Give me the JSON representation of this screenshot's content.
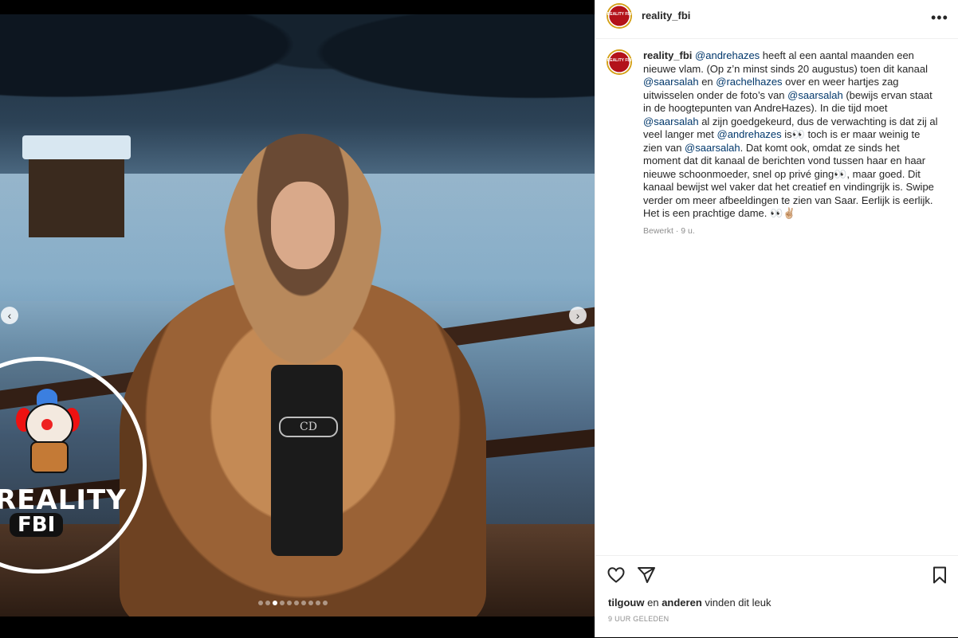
{
  "post": {
    "username": "reality_fbi",
    "avatar_text": "REALITY FBI",
    "more_icon": "more-horizontal-icon",
    "image_alt_logo": {
      "line1": "REALITY",
      "line2": "FBI"
    },
    "belt_text": "CD",
    "carousel": {
      "total": 10,
      "active_index": 2
    }
  },
  "caption": {
    "username": "reality_fbi",
    "segments": [
      {
        "t": "text",
        "v": " "
      },
      {
        "t": "mention",
        "v": "@andrehazes"
      },
      {
        "t": "text",
        "v": " heeft al een aantal maanden een nieuwe vlam. (Op z’n minst sinds 20 augustus) toen dit kanaal "
      },
      {
        "t": "mention",
        "v": "@saarsalah"
      },
      {
        "t": "text",
        "v": " en "
      },
      {
        "t": "mention",
        "v": "@rachelhazes"
      },
      {
        "t": "text",
        "v": " over en weer hartjes zag uitwisselen onder de foto’s van "
      },
      {
        "t": "mention",
        "v": "@saarsalah"
      },
      {
        "t": "text",
        "v": " (bewijs ervan staat in de hoogtepunten van AndreHazes). In die tijd moet "
      },
      {
        "t": "mention",
        "v": "@saarsalah"
      },
      {
        "t": "text",
        "v": " al zijn goedgekeurd, dus de verwachting is dat zij al veel langer met "
      },
      {
        "t": "mention",
        "v": "@andrehazes"
      },
      {
        "t": "text",
        "v": " is👀 toch is er maar weinig te zien van "
      },
      {
        "t": "mention",
        "v": "@saarsalah"
      },
      {
        "t": "text",
        "v": ". Dat komt ook, omdat ze sinds het moment dat dit kanaal de berichten vond tussen haar en haar nieuwe schoonmoeder, snel op privé ging👀, maar goed. Dit kanaal bewijst wel vaker dat het creatief en vindingrijk is. Swipe verder om meer afbeeldingen te zien van Saar. Eerlijk is eerlijk. Het is een prachtige dame. 👀✌🏼"
      }
    ],
    "meta": "Bewerkt · 9 u."
  },
  "actions": {
    "like_icon": "heart-icon",
    "share_icon": "send-icon",
    "save_icon": "bookmark-icon",
    "likes": {
      "user": "tilgouw",
      "connector": " en ",
      "others": "anderen",
      "suffix": " vinden dit leuk"
    },
    "time_ago": "9 UUR GELEDEN"
  },
  "colors": {
    "mention": "#00376b",
    "text": "#262626",
    "muted": "#8e8e8e",
    "divider": "#efefef"
  }
}
